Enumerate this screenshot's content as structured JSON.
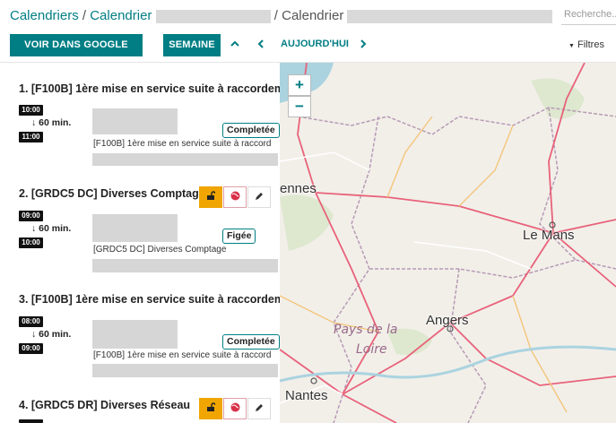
{
  "breadcrumb": {
    "root": "Calendriers",
    "sep1": "/",
    "second": "Calendrier",
    "sep2": "/",
    "third": "Calendrier"
  },
  "search": {
    "placeholder": "Recherche..."
  },
  "toolbar": {
    "google_maps_label": "VOIR DANS GOOGLE MAPS",
    "week_label": "SEMAINE",
    "today_label": "AUJOURD'HUI",
    "filters_label": "Filtres",
    "filter_icon": "▼"
  },
  "items": [
    {
      "title": "1. [F100B] 1ère mise en service suite à raccordem",
      "start": "10:00",
      "duration": "↓ 60 min.",
      "end": "11:00",
      "status": "Completée",
      "desc": "[F100B] 1ère mise en service suite à raccord"
    },
    {
      "title": "2. [GRDC5 DC] Diverses Comptage",
      "start": "09:00",
      "duration": "↓ 60 min.",
      "end": "10:00",
      "status": "Figée",
      "desc": "[GRDC5 DC] Diverses Comptage"
    },
    {
      "title": "3. [F100B] 1ère mise en service suite à raccordem",
      "start": "08:00",
      "duration": "↓ 60 min.",
      "end": "09:00",
      "status": "Completée",
      "desc": "[F100B] 1ère mise en service suite à raccord"
    },
    {
      "title": "4. [GRDC5 DR] Diverses Réseau"
    }
  ],
  "map": {
    "zoom_in": "+",
    "zoom_out": "−",
    "cities": {
      "rennes": "ennes",
      "le_mans": "Le Mans",
      "angers": "Angers",
      "nantes": "Nantes"
    },
    "region_line1": "Pays de la",
    "region_line2": "Loire"
  },
  "colors": {
    "accent": "#017e84",
    "lock": "#f0a500",
    "road": "#e8627a"
  }
}
